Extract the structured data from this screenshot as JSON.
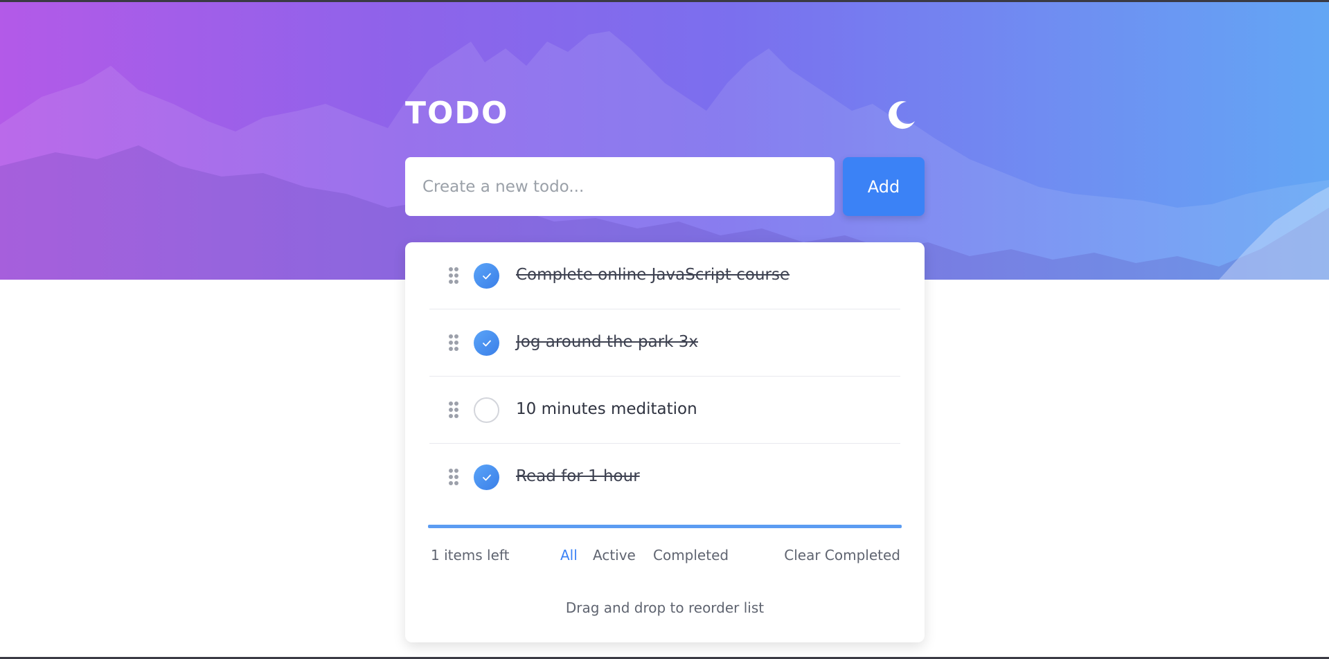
{
  "header": {
    "title": "TODO",
    "theme_icon": "moon-icon"
  },
  "new_todo": {
    "placeholder": "Create a new todo...",
    "value": "",
    "add_label": "Add"
  },
  "todos": [
    {
      "text": "Complete online JavaScript course",
      "completed": true
    },
    {
      "text": "Jog around the park 3x",
      "completed": true
    },
    {
      "text": "10 minutes meditation",
      "completed": false
    },
    {
      "text": "Read for 1 hour",
      "completed": true
    }
  ],
  "footer": {
    "items_left": "1 items left",
    "filters": [
      {
        "label": "All",
        "active": true
      },
      {
        "label": "Active",
        "active": false
      },
      {
        "label": "Completed",
        "active": false
      }
    ],
    "clear_label": "Clear Completed"
  },
  "hint": "Drag and drop to reorder list",
  "colors": {
    "accent": "#3b82f6",
    "gradient_start": "#b35ae8",
    "gradient_end": "#63a6f4",
    "check_fill": "#4a90f0",
    "drop_indicator": "#5b9cf2"
  }
}
